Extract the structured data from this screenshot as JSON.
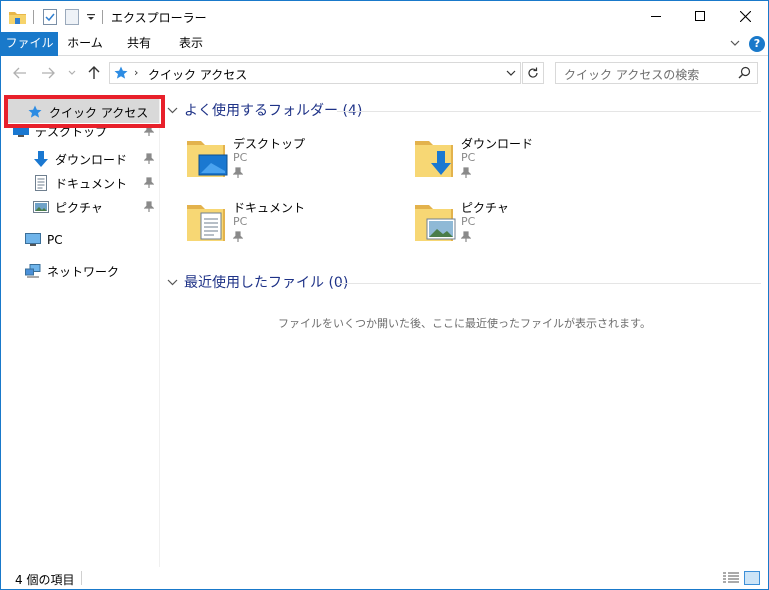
{
  "window": {
    "title": "エクスプローラー",
    "accent_color": "#1979ca"
  },
  "ribbon": {
    "tabs": [
      {
        "label": "ファイル"
      },
      {
        "label": "ホーム"
      },
      {
        "label": "共有"
      },
      {
        "label": "表示"
      }
    ],
    "help_label": "?"
  },
  "address": {
    "location": "クイック アクセス",
    "search_placeholder": "クイック アクセスの検索"
  },
  "navpane": {
    "quick_access": "クイック アクセス",
    "pinned": [
      {
        "label": "デスクトップ",
        "icon": "desktop-icon"
      },
      {
        "label": "ダウンロード",
        "icon": "download-icon"
      },
      {
        "label": "ドキュメント",
        "icon": "document-icon"
      },
      {
        "label": "ピクチャ",
        "icon": "picture-icon"
      }
    ],
    "pc": "PC",
    "network": "ネットワーク"
  },
  "content": {
    "frequent_header": "よく使用するフォルダー (4)",
    "folders": [
      {
        "name": "デスクトップ",
        "location": "PC"
      },
      {
        "name": "ダウンロード",
        "location": "PC"
      },
      {
        "name": "ドキュメント",
        "location": "PC"
      },
      {
        "name": "ピクチャ",
        "location": "PC"
      }
    ],
    "recent_header": "最近使用したファイル (0)",
    "recent_empty": "ファイルをいくつか開いた後、ここに最近使ったファイルが表示されます。"
  },
  "status": {
    "item_count": "4 個の項目"
  }
}
